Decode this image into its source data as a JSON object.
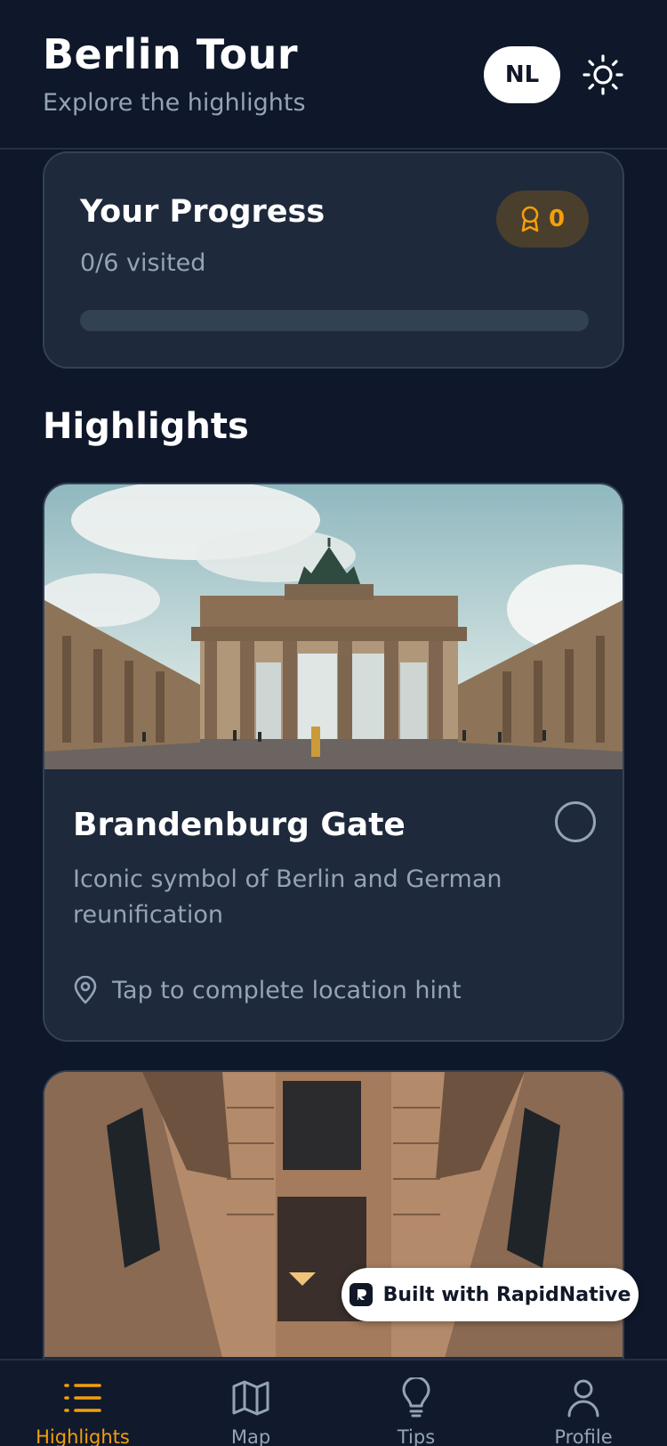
{
  "header": {
    "title": "Berlin Tour",
    "subtitle": "Explore the highlights",
    "language": "NL",
    "theme_icon": "sun-icon"
  },
  "progress": {
    "title": "Your Progress",
    "visited_text": "0/6 visited",
    "badge_count": "0",
    "badge_icon": "award-icon",
    "fraction": 0
  },
  "section": {
    "title": "Highlights"
  },
  "highlights": [
    {
      "title": "Brandenburg Gate",
      "description": "Iconic symbol of Berlin and German reunification",
      "hint": "Tap to complete location hint",
      "visited": false
    },
    {
      "title": "",
      "description": "",
      "hint": "",
      "visited": false
    }
  ],
  "built_badge": {
    "label": "Built with RapidNative"
  },
  "tabs": [
    {
      "label": "Highlights",
      "icon": "list-icon",
      "active": true
    },
    {
      "label": "Map",
      "icon": "map-icon",
      "active": false
    },
    {
      "label": "Tips",
      "icon": "lightbulb-icon",
      "active": false
    },
    {
      "label": "Profile",
      "icon": "user-icon",
      "active": false
    }
  ],
  "colors": {
    "background": "#0f172a",
    "card": "#1e293b",
    "accent": "#f59e0b",
    "muted_text": "#94a3b8"
  }
}
